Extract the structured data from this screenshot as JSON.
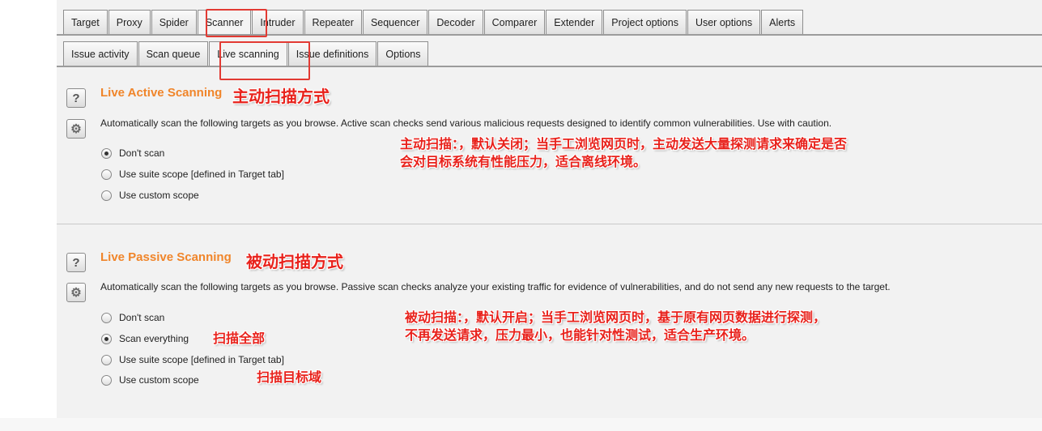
{
  "main_tabs": [
    {
      "label": "Target"
    },
    {
      "label": "Proxy"
    },
    {
      "label": "Spider"
    },
    {
      "label": "Scanner",
      "active": true
    },
    {
      "label": "Intruder"
    },
    {
      "label": "Repeater"
    },
    {
      "label": "Sequencer"
    },
    {
      "label": "Decoder"
    },
    {
      "label": "Comparer"
    },
    {
      "label": "Extender"
    },
    {
      "label": "Project options"
    },
    {
      "label": "User options"
    },
    {
      "label": "Alerts"
    }
  ],
  "scanner_tabs": [
    {
      "label": "Issue activity"
    },
    {
      "label": "Scan queue"
    },
    {
      "label": "Live scanning",
      "active": true
    },
    {
      "label": "Issue definitions"
    },
    {
      "label": "Options"
    }
  ],
  "live_active": {
    "title": "Live Active Scanning",
    "annotation": "主动扫描方式",
    "description": "Automatically scan the following targets as you browse. Active scan checks send various malicious requests designed to identify common vulnerabilities. Use with caution.",
    "options": [
      {
        "label": "Don't scan",
        "selected": true
      },
      {
        "label": "Use suite scope [defined in Target tab]",
        "selected": false
      },
      {
        "label": "Use custom scope",
        "selected": false
      }
    ],
    "note_line1": "主动扫描：，默认关闭；当手工浏览网页时，主动发送大量探测请求来确定是否",
    "note_line2": "会对目标系统有性能压力，适合离线环境。"
  },
  "live_passive": {
    "title": "Live Passive Scanning",
    "annotation": "被动扫描方式",
    "description": "Automatically scan the following targets as you browse. Passive scan checks analyze your existing traffic for evidence of vulnerabilities, and do not send any new requests to the target.",
    "options": [
      {
        "label": "Don't scan",
        "selected": false
      },
      {
        "label": "Scan everything",
        "selected": true
      },
      {
        "label": "Use suite scope [defined in Target tab]",
        "selected": false
      },
      {
        "label": "Use custom scope",
        "selected": false
      }
    ],
    "note_line1": "被动扫描：，默认开启；当手工浏览网页时，基于原有网页数据进行探测，",
    "note_line2": "不再发送请求，压力最小，也能针对性测试，适合生产环境。",
    "note_scan_everything": "扫描全部",
    "note_custom_scope": "扫描目标域"
  },
  "icons": {
    "help": "?",
    "gear": "⚙"
  },
  "colors": {
    "section_title": "#f0852a",
    "annotation": "#e8211b",
    "highlight_box": "#e23a33"
  }
}
